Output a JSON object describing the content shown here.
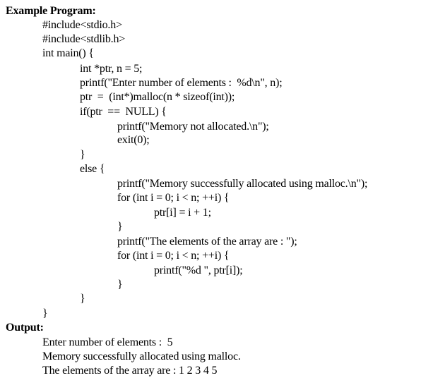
{
  "document": {
    "program_heading": "Example Program:",
    "code_lines": [
      "#include<stdio.h>",
      "#include<stdlib.h>",
      "int main() {",
      "int *ptr, n = 5;",
      "printf(\"Enter number of elements :  %d\\n\", n);",
      "ptr  =  (int*)malloc(n * sizeof(int));",
      "if(ptr  ==  NULL) {",
      "printf(\"Memory not allocated.\\n\");",
      "exit(0);",
      "}",
      "else {",
      "printf(\"Memory successfully allocated using malloc.\\n\");",
      "for (int i = 0; i < n; ++i) {",
      "ptr[i] = i + 1;",
      "}",
      "printf(\"The elements of the array are : \");",
      "for (int i = 0; i < n; ++i) {",
      "printf(\"%d \", ptr[i]);",
      "}",
      "}",
      "}"
    ],
    "output_heading": "Output:",
    "output_lines": [
      "Enter number of elements :  5",
      "Memory successfully allocated using malloc.",
      "The elements of the array are : 1 2 3 4 5"
    ]
  }
}
